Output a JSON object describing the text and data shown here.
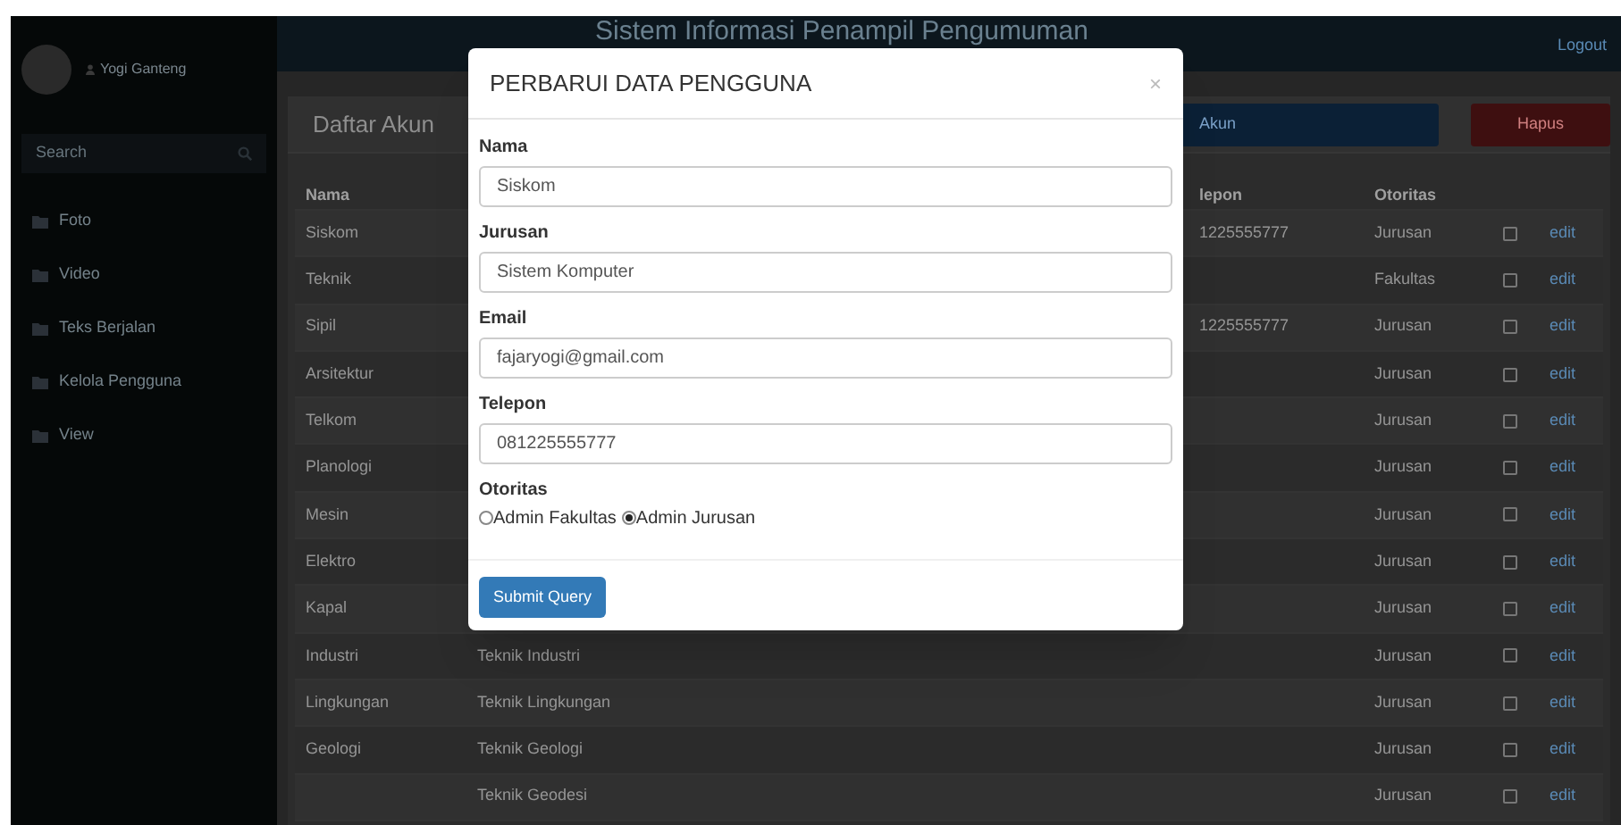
{
  "header": {
    "title": "Sistem Informasi Penampil Pengumuman",
    "logout": "Logout"
  },
  "sidebar": {
    "user": "Yogi Ganteng",
    "search": {
      "placeholder": "Search"
    },
    "items": [
      {
        "label": "Foto"
      },
      {
        "label": "Video"
      },
      {
        "label": "Teks Berjalan"
      },
      {
        "label": "Kelola Pengguna"
      },
      {
        "label": "View"
      }
    ]
  },
  "panel": {
    "title": "Daftar Akun",
    "buttons": [
      {
        "label": "Akun",
        "kind": "primary"
      },
      {
        "label": "Hapus",
        "kind": "danger"
      }
    ]
  },
  "table": {
    "header": {
      "nama": "Nama",
      "telepon": "lepon",
      "otoritas": "Otoritas"
    },
    "rows": [
      {
        "nama": "Siskom",
        "telepon": "1225555777",
        "otoritas": "Jurusan",
        "checked": false,
        "action": "edit"
      },
      {
        "nama": "Teknik",
        "otoritas": "Fakultas",
        "checked": false,
        "action": "edit"
      },
      {
        "nama": "Sipil",
        "telepon": "1225555777",
        "otoritas": "Jurusan",
        "checked": false,
        "action": "edit"
      },
      {
        "nama": "Arsitektur",
        "otoritas": "Jurusan",
        "checked": false,
        "action": "edit"
      },
      {
        "nama": "Telkom",
        "otoritas": "Jurusan",
        "checked": false,
        "action": "edit"
      },
      {
        "nama": "Planologi",
        "otoritas": "Jurusan",
        "checked": false,
        "action": "edit"
      },
      {
        "nama": "Mesin",
        "otoritas": "Jurusan",
        "checked": false,
        "action": "edit"
      },
      {
        "nama": "Elektro",
        "otoritas": "Jurusan",
        "checked": false,
        "action": "edit"
      },
      {
        "nama": "Kapal",
        "otoritas": "Jurusan",
        "checked": false,
        "action": "edit"
      },
      {
        "nama": "Industri",
        "jurusan": "Teknik Industri",
        "otoritas": "Jurusan",
        "checked": false,
        "action": "edit"
      },
      {
        "nama": "Lingkungan",
        "jurusan": "Teknik Lingkungan",
        "otoritas": "Jurusan",
        "checked": false,
        "action": "edit"
      },
      {
        "nama": "Geologi",
        "jurusan": "Teknik Geologi",
        "otoritas": "Jurusan",
        "checked": false,
        "action": "edit"
      },
      {
        "jurusan": "Teknik Geodesi",
        "otoritas": "Jurusan",
        "checked": false,
        "action": "edit"
      }
    ]
  },
  "modal": {
    "title": "PERBARUI DATA PENGGUNA",
    "close": "×",
    "fields": [
      {
        "label": "Nama",
        "value": "Siskom"
      },
      {
        "label": "Jurusan",
        "value": "Sistem Komputer"
      },
      {
        "label": "Email",
        "value": "fajaryogi@gmail.com"
      },
      {
        "label": "Telepon",
        "value": "081225555777"
      }
    ],
    "authority": {
      "label": "Otoritas",
      "options": [
        {
          "label": "Admin Fakultas",
          "selected": false
        },
        {
          "label": "Admin Jurusan",
          "selected": true
        }
      ]
    },
    "submit": "Submit Query"
  }
}
